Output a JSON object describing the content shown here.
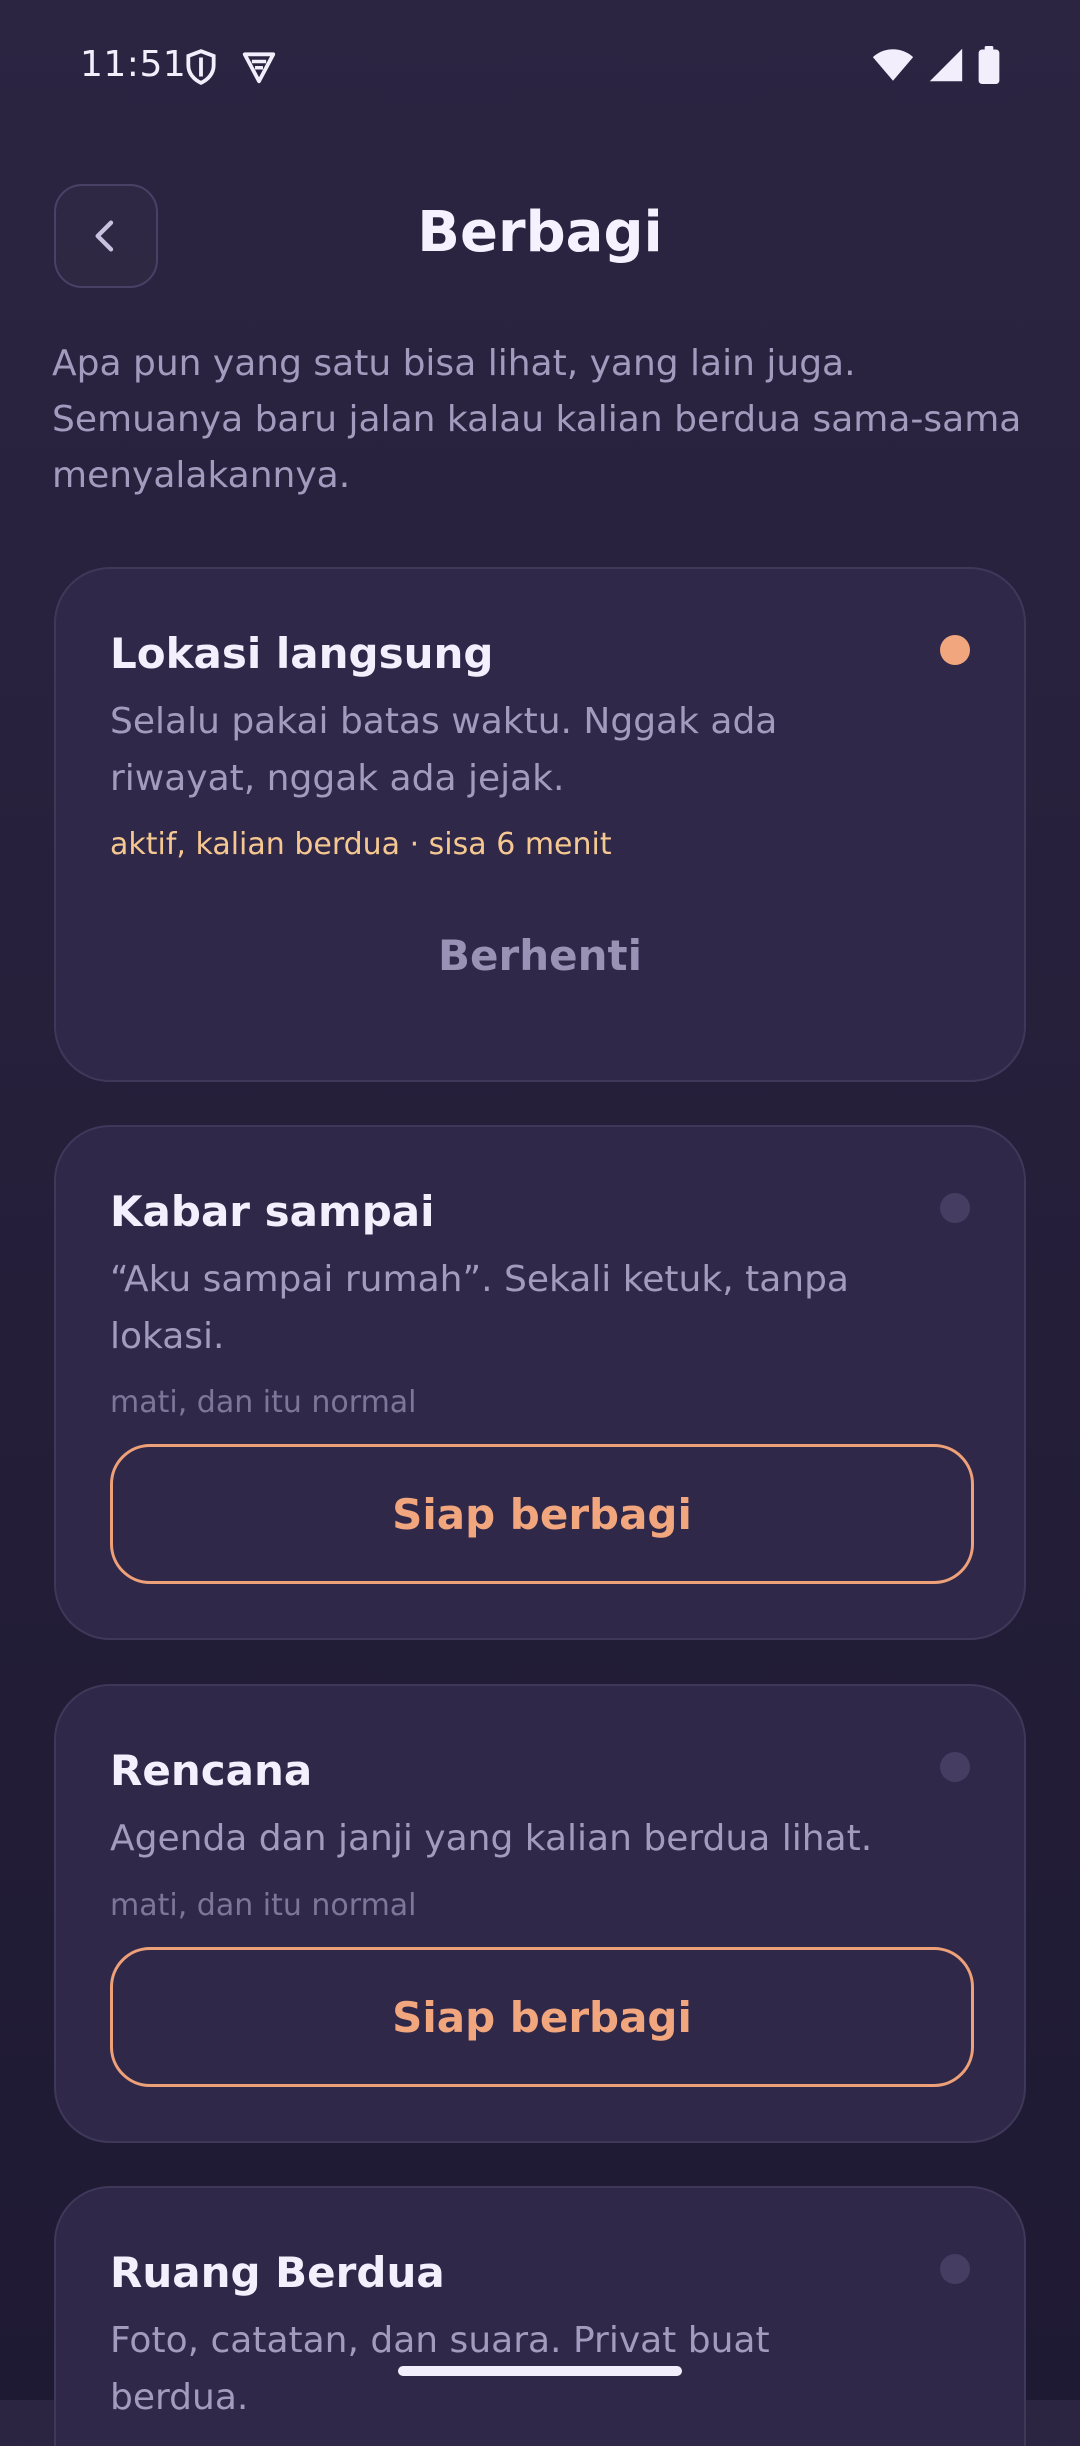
{
  "status_bar": {
    "time": "11:51",
    "icons": [
      "shield-icon",
      "vpn-icon",
      "wifi-icon",
      "signal-icon",
      "battery-icon"
    ]
  },
  "header": {
    "back_icon": "chevron-left-icon",
    "title": "Berbagi"
  },
  "intro": "Apa pun yang satu bisa lihat, yang lain juga. Semuanya baru jalan kalau kalian berdua sama-sama menyalakannya.",
  "cards": [
    {
      "title": "Lokasi langsung",
      "description": "Selalu pakai batas waktu. Nggak ada riwayat, nggak ada jejak.",
      "status": "aktif, kalian berdua · sisa 6 menit",
      "active": true,
      "action": "Berhenti"
    },
    {
      "title": "Kabar sampai",
      "description": "“Aku sampai rumah”. Sekali ketuk, tanpa lokasi.",
      "status": "mati, dan itu normal",
      "active": false,
      "action": "Siap berbagi"
    },
    {
      "title": "Rencana",
      "description": "Agenda dan janji yang kalian berdua lihat.",
      "status": "mati, dan itu normal",
      "active": false,
      "action": "Siap berbagi"
    },
    {
      "title": "Ruang Berdua",
      "description": "Foto, catatan, dan suara. Privat buat berdua.",
      "active": false
    }
  ],
  "colors": {
    "background": "#2b2542",
    "card": "#2f2849",
    "accent": "#f2a67e",
    "active_status": "#f6c891",
    "muted_text": "#a39bbd"
  }
}
